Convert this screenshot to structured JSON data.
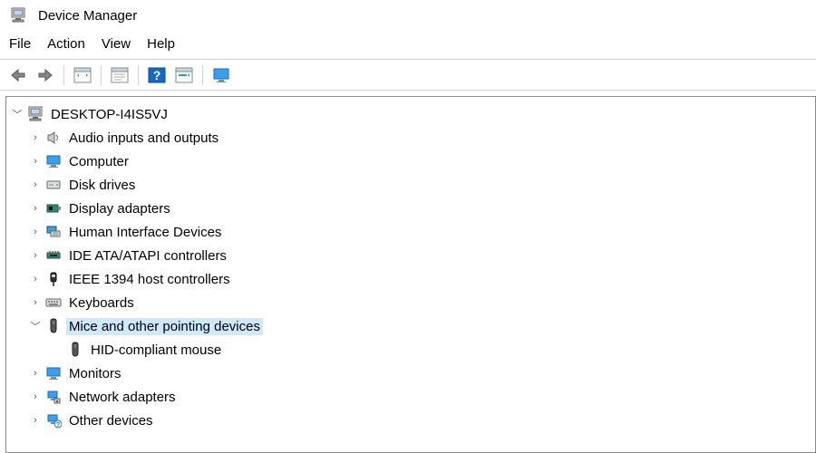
{
  "window": {
    "title": "Device Manager"
  },
  "menu": {
    "file": "File",
    "action": "Action",
    "view": "View",
    "help": "Help"
  },
  "tree": {
    "root": {
      "label": "DESKTOP-I4IS5VJ",
      "expanded": true
    },
    "categories": [
      {
        "label": "Audio inputs and outputs",
        "icon": "speaker",
        "expanded": false
      },
      {
        "label": "Computer",
        "icon": "monitor",
        "expanded": false
      },
      {
        "label": "Disk drives",
        "icon": "disk",
        "expanded": false
      },
      {
        "label": "Display adapters",
        "icon": "display-adapter",
        "expanded": false
      },
      {
        "label": "Human Interface Devices",
        "icon": "hid",
        "expanded": false
      },
      {
        "label": "IDE ATA/ATAPI controllers",
        "icon": "ide",
        "expanded": false
      },
      {
        "label": "IEEE 1394 host controllers",
        "icon": "firewire",
        "expanded": false
      },
      {
        "label": "Keyboards",
        "icon": "keyboard",
        "expanded": false
      },
      {
        "label": "Mice and other pointing devices",
        "icon": "mouse",
        "expanded": true,
        "selected": true,
        "children": [
          {
            "label": "HID-compliant mouse",
            "icon": "mouse"
          }
        ]
      },
      {
        "label": "Monitors",
        "icon": "monitor",
        "expanded": false
      },
      {
        "label": "Network adapters",
        "icon": "network",
        "expanded": false
      },
      {
        "label": "Other devices",
        "icon": "other",
        "expanded": false
      }
    ]
  }
}
